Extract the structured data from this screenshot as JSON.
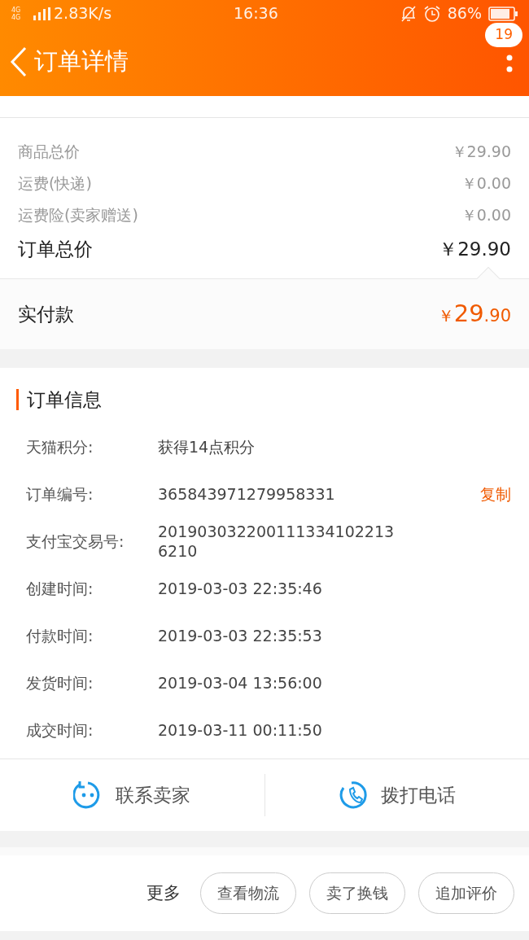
{
  "status_bar": {
    "network": "4G 4G",
    "speed": "2.83K/s",
    "time": "16:36",
    "battery": "86%"
  },
  "header": {
    "title": "订单详情",
    "badge": "19"
  },
  "prices": [
    {
      "label": "商品总价",
      "value": "￥29.90",
      "kind": "minor"
    },
    {
      "label": "运费(快递)",
      "value": "￥0.00",
      "kind": "minor"
    },
    {
      "label": "运费险(卖家赠送)",
      "value": "￥0.00",
      "kind": "minor"
    },
    {
      "label": "订单总价",
      "value": "￥29.90",
      "kind": "total"
    }
  ],
  "paid": {
    "label": "实付款",
    "currency": "￥",
    "integer": "29",
    "decimal": ".90"
  },
  "order_info": {
    "title": "订单信息",
    "rows": [
      {
        "label": "天猫积分:",
        "value": "获得14点积分"
      },
      {
        "label": "订单编号:",
        "value": "365843971279958331",
        "action": "复制"
      },
      {
        "label": "支付宝交易号:",
        "value": "2019030322001113341022136210"
      },
      {
        "label": "创建时间:",
        "value": "2019-03-03 22:35:46"
      },
      {
        "label": "付款时间:",
        "value": "2019-03-03 22:35:53"
      },
      {
        "label": "发货时间:",
        "value": "2019-03-04 13:56:00"
      },
      {
        "label": "成交时间:",
        "value": "2019-03-11 00:11:50"
      }
    ]
  },
  "contact": [
    {
      "label": "联系卖家",
      "kind": "chat"
    },
    {
      "label": "拨打电话",
      "kind": "phone"
    }
  ],
  "bottom_bar": {
    "more": "更多",
    "buttons": [
      "查看物流",
      "卖了换钱",
      "追加评价"
    ]
  }
}
